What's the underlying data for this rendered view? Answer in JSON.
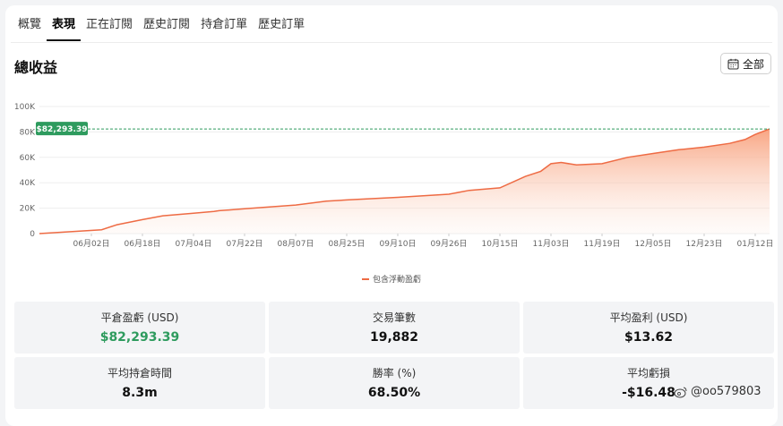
{
  "tabs": [
    {
      "label": "概覽",
      "active": false
    },
    {
      "label": "表現",
      "active": true
    },
    {
      "label": "正在訂閱",
      "active": false
    },
    {
      "label": "歷史訂閱",
      "active": false
    },
    {
      "label": "持倉訂單",
      "active": false
    },
    {
      "label": "歷史訂單",
      "active": false
    }
  ],
  "section_title": "總收益",
  "range_button": {
    "label": "全部",
    "icon": "calendar-icon"
  },
  "colors": {
    "line": "#ee6b44",
    "fill_top": "#f8a07c",
    "accent_green": "#2e9b5e",
    "marker_bg": "#2e9b5e"
  },
  "chart_data": {
    "type": "area",
    "current_value_label": "$82,293.39",
    "y_ticks": [
      "0",
      "20K",
      "40K",
      "60K",
      "80K",
      "100K"
    ],
    "ylim": [
      0,
      100000
    ],
    "x_ticks": [
      "06月02日",
      "06月18日",
      "07月04日",
      "07月22日",
      "08月07日",
      "08月25日",
      "09月10日",
      "09月26日",
      "10月15日",
      "11月03日",
      "11月19日",
      "12月05日",
      "12月23日",
      "01月12日"
    ],
    "x_index": [
      0,
      0.2,
      0.5,
      1,
      1.4,
      2,
      2.4,
      2.5,
      3,
      4,
      4.6,
      5,
      6,
      7,
      7.4,
      8,
      8.5,
      8.8,
      9,
      9.2,
      9.5,
      10,
      10.5,
      11,
      11.5,
      12,
      12.5,
      12.8,
      13,
      13.3
    ],
    "values": [
      0,
      3000,
      7000,
      11000,
      14000,
      16000,
      17500,
      18000,
      19500,
      22500,
      25500,
      26500,
      28500,
      31000,
      34000,
      36000,
      45000,
      49000,
      55000,
      56000,
      54000,
      55000,
      60000,
      63000,
      66000,
      68000,
      71000,
      74000,
      78000,
      82293
    ],
    "series": [
      {
        "name": "包含浮動盈虧"
      }
    ],
    "grid": true,
    "legend_position": "bottom-center"
  },
  "legend_label": "包含浮動盈虧",
  "stats": [
    {
      "label": "平倉盈虧 (USD)",
      "value": "$82,293.39",
      "highlight": true
    },
    {
      "label": "交易筆數",
      "value": "19,882",
      "highlight": false
    },
    {
      "label": "平均盈利 (USD)",
      "value": "$13.62",
      "highlight": false
    },
    {
      "label": "平均持倉時間",
      "value": "8.3m",
      "highlight": false
    },
    {
      "label": "勝率 (%)",
      "value": "68.50%",
      "highlight": false
    },
    {
      "label": "平均虧損",
      "value": "-$16.48",
      "highlight": false
    }
  ],
  "watermark": "@oo579803"
}
